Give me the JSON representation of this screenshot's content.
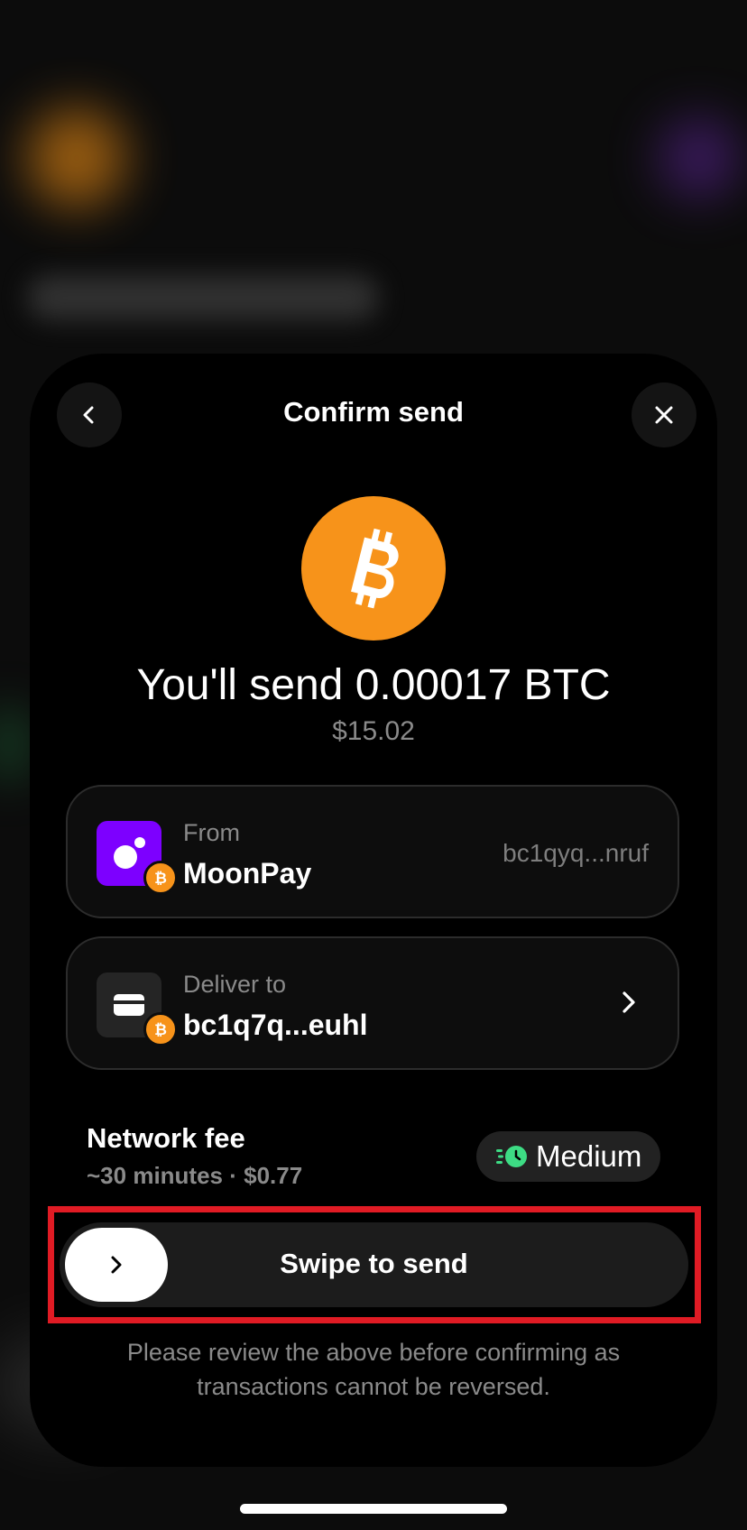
{
  "header": {
    "title": "Confirm send",
    "back_icon": "chevron-left-icon",
    "close_icon": "close-icon"
  },
  "summary": {
    "coin_icon": "bitcoin-icon",
    "amount_text": "You'll send 0.00017 BTC",
    "fiat_value": "$15.02"
  },
  "from": {
    "label": "From",
    "name": "MoonPay",
    "address": "bc1qyq...nruf",
    "icon": "moonpay-icon"
  },
  "deliver": {
    "label": "Deliver to",
    "address": "bc1q7q...euhl",
    "icon": "wallet-icon"
  },
  "fee": {
    "title": "Network fee",
    "detail": "~30 minutes · $0.77",
    "speed": "Medium",
    "speed_icon": "speed-clock-icon"
  },
  "swipe": {
    "label": "Swipe to send"
  },
  "disclaimer": "Please review the above before confirming as transactions cannot be reversed.",
  "colors": {
    "bitcoin": "#f7931a",
    "moonpay": "#7d00ff",
    "fee_icon": "#3ddc84",
    "highlight": "#e01b24"
  }
}
